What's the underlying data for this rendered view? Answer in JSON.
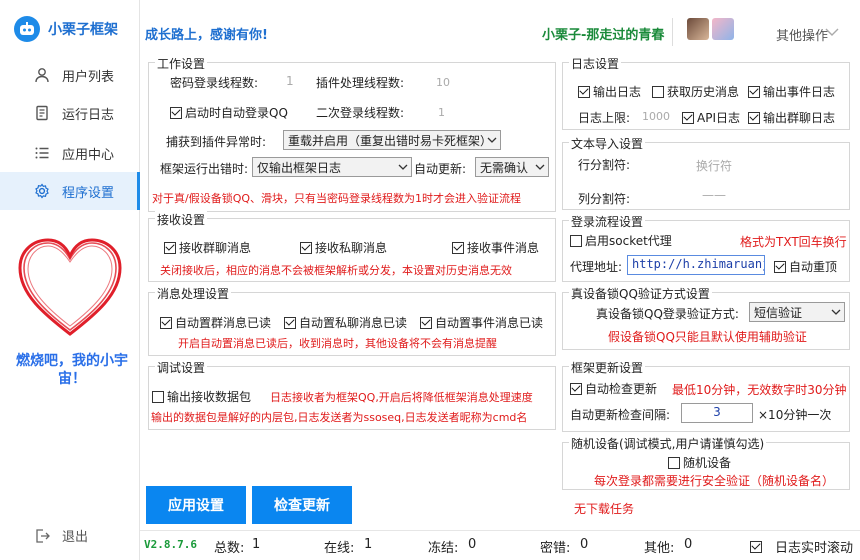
{
  "sidebar": {
    "brand": "小栗子框架",
    "items": [
      {
        "label": "用户列表"
      },
      {
        "label": "运行日志"
      },
      {
        "label": "应用中心"
      },
      {
        "label": "程序设置"
      }
    ],
    "slogan": "燃烧吧，我的小宇宙！",
    "logout": "退出"
  },
  "header": {
    "motto": "成长路上，感谢有你!",
    "user": "小栗子-那走过的青春",
    "more": "其他操作"
  },
  "work": {
    "title": "工作设置",
    "pwd_threads_label": "密码登录线程数:",
    "pwd_threads": "1",
    "plugin_threads_label": "插件处理线程数:",
    "plugin_threads": "10",
    "autologin": "启动时自动登录QQ",
    "second_threads_label": "二次登录线程数:",
    "second_threads": "1",
    "exception_label": "捕获到插件异常时:",
    "exception_value": "重载并启用（重复出错时易卡死框架）",
    "error_label": "框架运行出错时:",
    "error_value": "仅输出框架日志",
    "autoupdate_label": "自动更新:",
    "autoupdate_value": "无需确认",
    "note": "对于真/假设备锁QQ、滑块，只有当密码登录线程数为1时才会进入验证流程"
  },
  "receive": {
    "title": "接收设置",
    "group": "接收群聊消息",
    "private": "接收私聊消息",
    "event": "接收事件消息",
    "note": "关闭接收后，相应的消息不会被框架解析或分发，本设置对历史消息无效"
  },
  "msgproc": {
    "title": "消息处理设置",
    "group": "自动置群消息已读",
    "private": "自动置私聊消息已读",
    "event": "自动置事件消息已读",
    "note": "开启自动置消息已读后，收到消息时，其他设备将不会有消息提醒"
  },
  "debug": {
    "title": "调试设置",
    "output_packets": "输出接收数据包",
    "note1": "日志接收者为框架QQ,开启后将降低框架消息处理速度",
    "note2": "输出的数据包是解好的内层包,日志发送者为ssoseq,日志发送者昵称为cmd名"
  },
  "log": {
    "title": "日志设置",
    "output_log": "输出日志",
    "history": "获取历史消息",
    "event_log": "输出事件日志",
    "limit_label": "日志上限:",
    "limit_value": "1000",
    "api_log": "API日志",
    "group_log": "输出群聊日志"
  },
  "text_import": {
    "title": "文本导入设置",
    "row_sep_label": "行分割符:",
    "row_sep_value": "换行符",
    "col_sep_label": "列分割符:",
    "col_sep_value": "——"
  },
  "login_flow": {
    "title": "登录流程设置",
    "socket_proxy": "启用socket代理",
    "hint": "格式为TXT回车换行",
    "proxy_label": "代理地址:",
    "proxy_value": "http://h.zhimaruanjian.com",
    "auto_retry": "自动重顶"
  },
  "device_lock": {
    "title": "真设备锁QQ验证方式设置",
    "method_label": "真设备锁QQ登录验证方式:",
    "method_value": "短信验证",
    "note": "假设备锁QQ只能且默认使用辅助验证"
  },
  "framework_update": {
    "title": "框架更新设置",
    "auto_check": "自动检查更新",
    "hint": "最低10分钟，无效数字时30分钟",
    "interval_label": "自动更新检查间隔:",
    "interval_value": "3",
    "interval_unit": "×10分钟一次"
  },
  "random_device": {
    "title": "随机设备(调试模式,用户请谨慎勾选)",
    "checkbox": "随机设备",
    "note": "每次登录都需要进行安全验证（随机设备名）"
  },
  "buttons": {
    "apply": "应用设置",
    "check_update": "检查更新"
  },
  "download_status": "无下载任务",
  "status": {
    "version": "V2.8.7.6",
    "total_label": "总数:",
    "total": "1",
    "online_label": "在线:",
    "online": "1",
    "frozen_label": "冻结:",
    "frozen": "0",
    "pwd_label": "密错:",
    "pwd": "0",
    "other_label": "其他:",
    "other": "0",
    "realtime_log": "日志实时滚动"
  },
  "colors": {
    "accent": "#0a86f0",
    "note_red": "#e01b1b",
    "user_green": "#1a8a3a",
    "heart": "#e01f2a"
  }
}
